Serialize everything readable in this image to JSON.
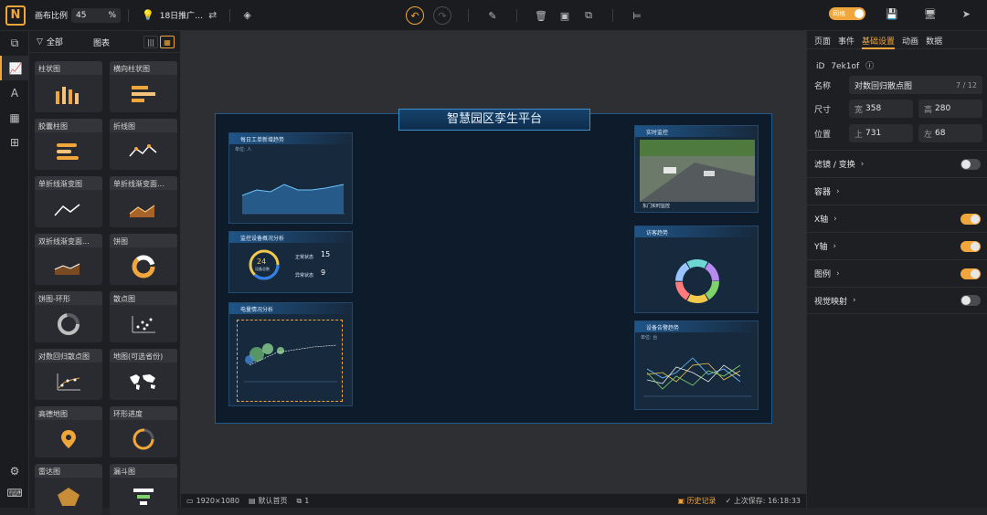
{
  "toolbar": {
    "logo": "N",
    "scale_label": "画布比例",
    "scale_value": "45",
    "scale_unit": "%",
    "project_name": "18日推广…",
    "toggle_label": "网格"
  },
  "left_panel": {
    "filter_all": "全部",
    "title": "图表",
    "cards": [
      {
        "label": "柱状图",
        "icon": "bar-chart"
      },
      {
        "label": "横向柱状图",
        "icon": "horizontal-bar-chart"
      },
      {
        "label": "胶囊柱图",
        "icon": "capsule-bar-chart"
      },
      {
        "label": "折线图",
        "icon": "line-chart"
      },
      {
        "label": "单折线渐变图",
        "icon": "gradient-line-chart"
      },
      {
        "label": "单折线渐变面...",
        "icon": "gradient-area-chart"
      },
      {
        "label": "双折线渐变面...",
        "icon": "double-area-chart"
      },
      {
        "label": "饼图",
        "icon": "pie-chart"
      },
      {
        "label": "饼图-环形",
        "icon": "ring-chart"
      },
      {
        "label": "散点图",
        "icon": "scatter-chart"
      },
      {
        "label": "对数回归散点图",
        "icon": "log-scatter-chart"
      },
      {
        "label": "地图(可选省份)",
        "icon": "world-map"
      },
      {
        "label": "高德地图",
        "icon": "map-pin"
      },
      {
        "label": "环形进度",
        "icon": "ring-progress"
      },
      {
        "label": "雷达图",
        "icon": "radar-chart"
      },
      {
        "label": "漏斗图",
        "icon": "funnel-chart"
      }
    ]
  },
  "canvas": {
    "screen_title": "智慧园区孪生平台",
    "widgets": {
      "w1_title": "每日工单新增趋势",
      "w1_unit": "单位: 人",
      "w1_yticks": [
        "200",
        "150",
        "100",
        "50",
        "0"
      ],
      "w2_title": "监控设备概况分析",
      "w2_center_value": "24",
      "w2_center_label": "设备总数",
      "w2_normal_label": "正常状态",
      "w2_normal_value": "15",
      "w2_abnormal_label": "异常状态",
      "w2_abnormal_value": "9",
      "w3_title": "电量情况分析",
      "w4_title": "实时监控",
      "w4_caption": "东门实时监控",
      "w5_title": "访客趋势",
      "w6_title": "设备告警趋势",
      "w6_unit": "单位: 台"
    }
  },
  "statusbar": {
    "resolution": "1920×1080",
    "home": "默认首页",
    "count": "1",
    "history": "历史记录",
    "last_save_label": "上次保存:",
    "last_save_time": "16:18:33"
  },
  "props": {
    "tabs": [
      "页面",
      "事件",
      "基础设置",
      "动画",
      "数据"
    ],
    "id_label": "iD",
    "id_value": "7ek1of",
    "name_label": "名称",
    "name_value": "对数回归散点图",
    "name_count": "7 / 12",
    "size_label": "尺寸",
    "width_label": "宽",
    "width_value": "358",
    "height_label": "高",
    "height_value": "280",
    "pos_label": "位置",
    "top_label": "上",
    "top_value": "731",
    "left_label": "左",
    "left_value": "68",
    "sections": [
      {
        "label": "滤镜 / 变换",
        "on": false
      },
      {
        "label": "容器",
        "on": null
      },
      {
        "label": "X轴",
        "on": true
      },
      {
        "label": "Y轴",
        "on": true
      },
      {
        "label": "图例",
        "on": true
      },
      {
        "label": "视觉映射",
        "on": false
      }
    ]
  },
  "colors": {
    "accent": "#f0a63a",
    "panel": "#1e1f23",
    "canvas": "#2e2f33",
    "screen_bg": "#0d1b2a"
  }
}
